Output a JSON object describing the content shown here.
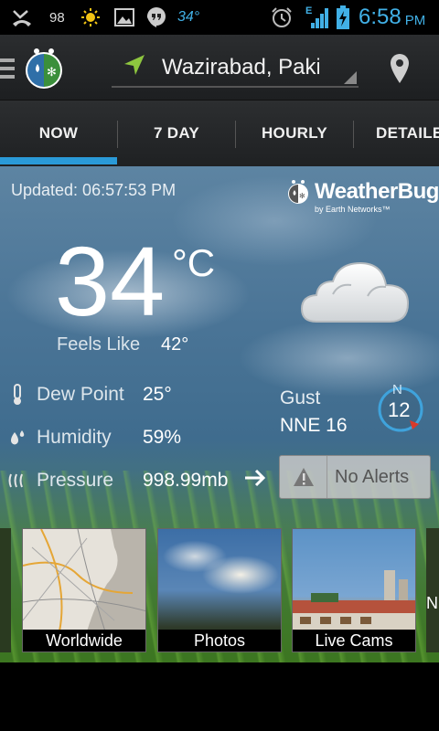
{
  "status_bar": {
    "battery_percent": "98",
    "temp": "34°",
    "time": "6:58",
    "ampm": "PM",
    "network": "E",
    "icons": [
      "missed-call-icon",
      "sun-icon",
      "image-icon",
      "hangouts-icon",
      "alarm-icon",
      "signal-icon",
      "battery-icon"
    ]
  },
  "app_bar": {
    "location": "Wazirabad, Paki",
    "icons": [
      "menu-icon",
      "weatherbug-app-icon",
      "location-arrow-icon",
      "map-pin-icon"
    ]
  },
  "tabs": [
    {
      "label": "NOW",
      "selected": true
    },
    {
      "label": "7 DAY",
      "selected": false
    },
    {
      "label": "HOURLY",
      "selected": false
    },
    {
      "label": "DETAILE",
      "selected": false
    }
  ],
  "current": {
    "updated": "Updated: 06:57:53 PM",
    "brand": "WeatherBug",
    "brand_sub": "by Earth Networks™",
    "temperature": "34",
    "unit": "°C",
    "feels_like_label": "Feels Like",
    "feels_like_value": "42°",
    "condition_icon": "cloudy-icon"
  },
  "details": {
    "dew_point_label": "Dew Point",
    "dew_point_value": "25°",
    "humidity_label": "Humidity",
    "humidity_value": "59%",
    "pressure_label": "Pressure",
    "pressure_value": "998.99mb",
    "pressure_trend": "rising"
  },
  "wind": {
    "gust_label": "Gust",
    "gust_value": "NNE 16",
    "compass_dir": "N",
    "compass_speed": "12"
  },
  "alerts": {
    "label": "No Alerts"
  },
  "thumbnails": [
    {
      "label": "Worldwide"
    },
    {
      "label": "Photos"
    },
    {
      "label": "Live Cams"
    },
    {
      "label": "N"
    }
  ],
  "colors": {
    "accent": "#2a9ad8",
    "status_blue": "#41b0e6",
    "location_arrow": "#8ec63f"
  }
}
